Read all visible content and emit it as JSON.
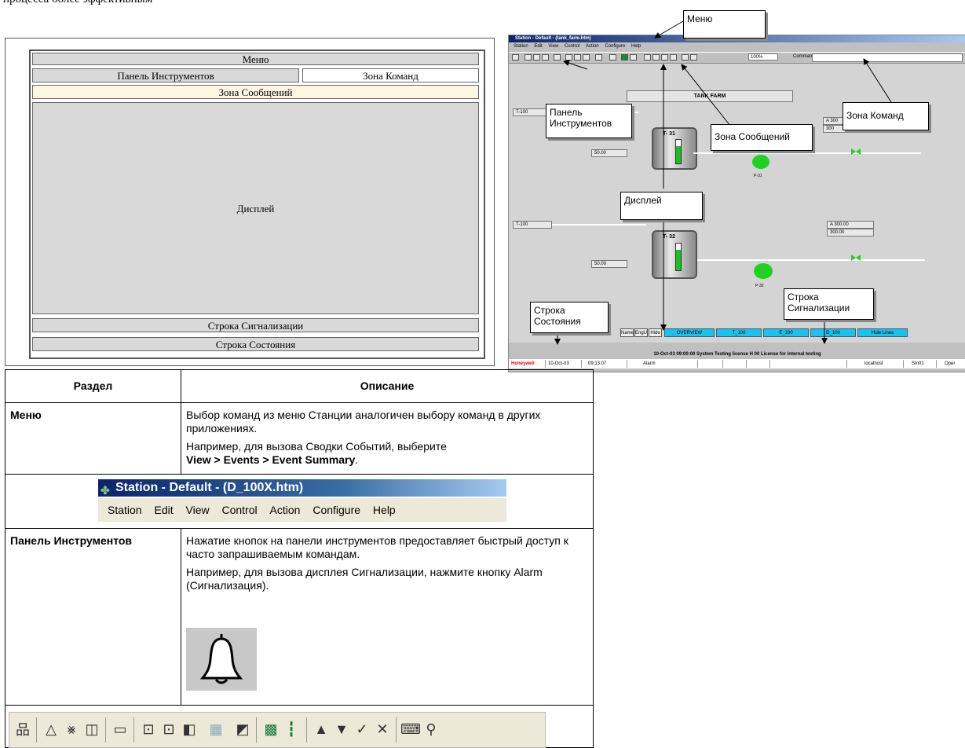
{
  "intro_fragment": "процесса более эффективным",
  "schema": {
    "menu": "Меню",
    "toolbar": "Панель Инструментов",
    "command_zone": "Зона Команд",
    "message_zone": "Зона Сообщений",
    "display": "Дисплей",
    "alarm_line": "Строка Сигнализации",
    "status_line": "Строка Состояния"
  },
  "screenshot": {
    "title": "Station - Default - (tank_farm.htm)",
    "menu_items": [
      "Station",
      "Edit",
      "View",
      "Control",
      "Action",
      "Configure",
      "Help"
    ],
    "zoom": "100%",
    "command_label": "Command",
    "display_title": "TANK FARM",
    "tags": {
      "t100a": "T-100",
      "t100b": "T-100",
      "sp1": "50.00",
      "sp2": "50.00",
      "t31": "T- 31",
      "t32": "T- 32",
      "p31": "P-31",
      "p32": "P-32",
      "a1": "A  300",
      "a1b": "300",
      "a2": "A   300.00",
      "a2b": "300.00"
    },
    "buttons": [
      "Name",
      "EngU",
      "Hide",
      "OVERVIEW",
      "T_100",
      "E_100",
      "D_100",
      "Hide Lines"
    ],
    "alarm_text": "10-Oct-03  09:00:00  System   Testing license   H 00 License for internal testing",
    "status": {
      "brand": "Honeywell",
      "date": "10-Oct-03",
      "time": "09:13:07",
      "alarm": "Alarm",
      "host": "localhost",
      "station": "Stn01",
      "mode": "Oper"
    },
    "colors": {
      "brand": "#e00000",
      "level": "#19c21c",
      "button": "#19c3f0"
    }
  },
  "callouts": {
    "menu": "Меню",
    "toolbar": "Панель Инструментов",
    "message": "Зона Сообщений",
    "command": "Зона Команд",
    "display": "Дисплей",
    "status": "Строка Состояния",
    "alarm": "Строка Сигнализации"
  },
  "table": {
    "header_section": "Раздел",
    "header_desc": "Описание",
    "rows": [
      {
        "name": "Меню",
        "p1": "Выбор команд из меню Станции аналогичен выбору команд в других приложениях.",
        "p2a": "Например, для вызова Сводки Событий, выберите",
        "p2b": "View > Events > Event Summary",
        "p2c": "."
      },
      {
        "name": "Панель Инструментов",
        "p1": "Нажатие кнопок на панели инструментов предоставляет быстрый доступ к часто запрашиваемым командам.",
        "p2": "Например, для вызова дисплея Сигнализации, нажмите кнопку Alarm (Сигнализация)."
      }
    ],
    "menu_image": {
      "title": "Station - Default - (D_100X.htm)",
      "items": [
        "Station",
        "Edit",
        "View",
        "Control",
        "Action",
        "Configure",
        "Help"
      ]
    },
    "toolbar_icons": [
      "station-tree-icon",
      "alarm-bell-icon",
      "silence-bell-icon",
      "book-icon",
      "page-icon",
      "page-down-icon",
      "page-up-icon",
      "detail-icon",
      "trend-icon",
      "refresh-icon",
      "chart-icon",
      "bars-icon",
      "raise-icon",
      "lower-icon",
      "check-icon",
      "cancel-icon",
      "keyboard-icon",
      "search-icon"
    ]
  }
}
